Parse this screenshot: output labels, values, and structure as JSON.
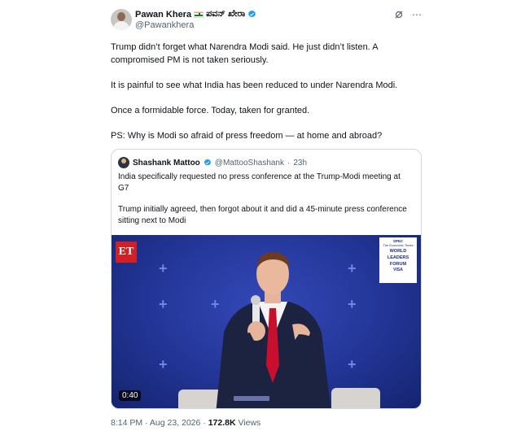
{
  "tweet": {
    "author_name": "Pawan Khera",
    "author_name_kannada": "ಪವನ್ ಖೇರಾ",
    "author_handle": "@Pawankhera",
    "paragraphs": [
      "Trump didn’t forget what Narendra Modi said. He just didn’t listen. A compromised PM is not taken seriously.",
      "It is painful to see what India has been reduced to under Narendra Modi.",
      "Once a formidable force. Today, taken for granted.",
      "PS: Why is Modi so afraid of press freedom — at home and abroad?"
    ],
    "time": "8:14 PM",
    "date": "Aug 23, 2026",
    "views_count": "172.8K",
    "views_label": "Views",
    "separator": "·",
    "accent_color": "#1d9bf0"
  },
  "quote": {
    "author_name": "Shashank Mattoo",
    "author_handle": "@MattooShashank",
    "age": "23h",
    "separator": "·",
    "paragraphs": [
      "India specifically requested no press conference at the Trump-Modi meeting at G7",
      "Trump initially agreed, then forgot about it and did a 45-minute press conference sitting next to Modi"
    ],
    "video": {
      "duration": "0:40",
      "logo_text": "ET",
      "event_badge_lines": [
        "SPEC",
        "The Economic Times",
        "WORLD",
        "LEADERS",
        "FORUM",
        "VISA"
      ]
    }
  },
  "icons": {
    "verified": "verified-badge-icon",
    "grok": "grok-icon",
    "more": "more-icon",
    "flag": "india-flag-icon"
  }
}
